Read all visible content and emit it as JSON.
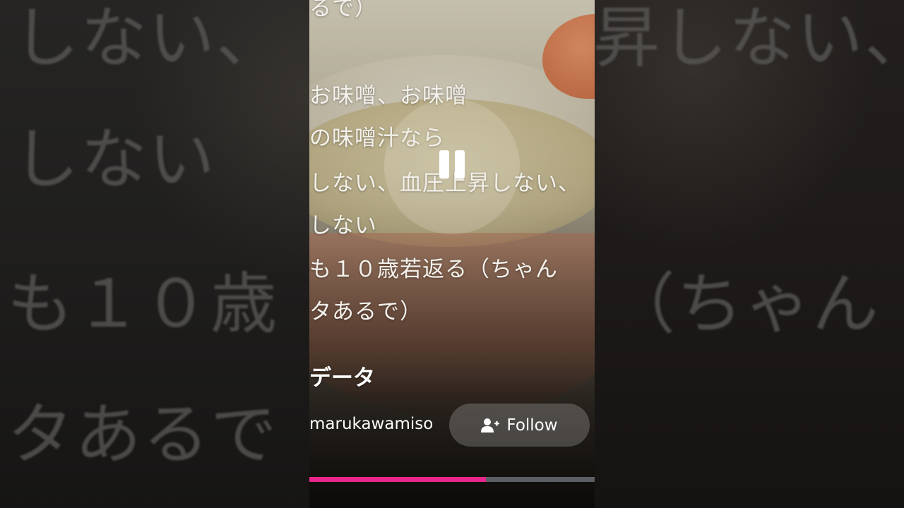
{
  "video": {
    "captions": [
      "るで）",
      "お味噌、お味噌",
      "の味噌汁なら",
      "しない、血圧上昇しない、",
      "しない",
      "も１０歳若返る（ちゃん",
      "タあるで）"
    ],
    "title": "データ",
    "channel": "marukawamiso",
    "follow_label": "Follow",
    "progress_percent": 62,
    "state": "paused"
  },
  "background": {
    "left_lines": [
      "しない、",
      "しない",
      "も１０歳",
      "タあるで"
    ],
    "right_lines": [
      "昇しない、",
      "（ちゃん"
    ]
  },
  "colors": {
    "progress_fill": "#e8268b",
    "progress_track": "#5b5e63"
  },
  "icons": {
    "play_state": "pause-icon",
    "follow": "person-plus-icon"
  }
}
